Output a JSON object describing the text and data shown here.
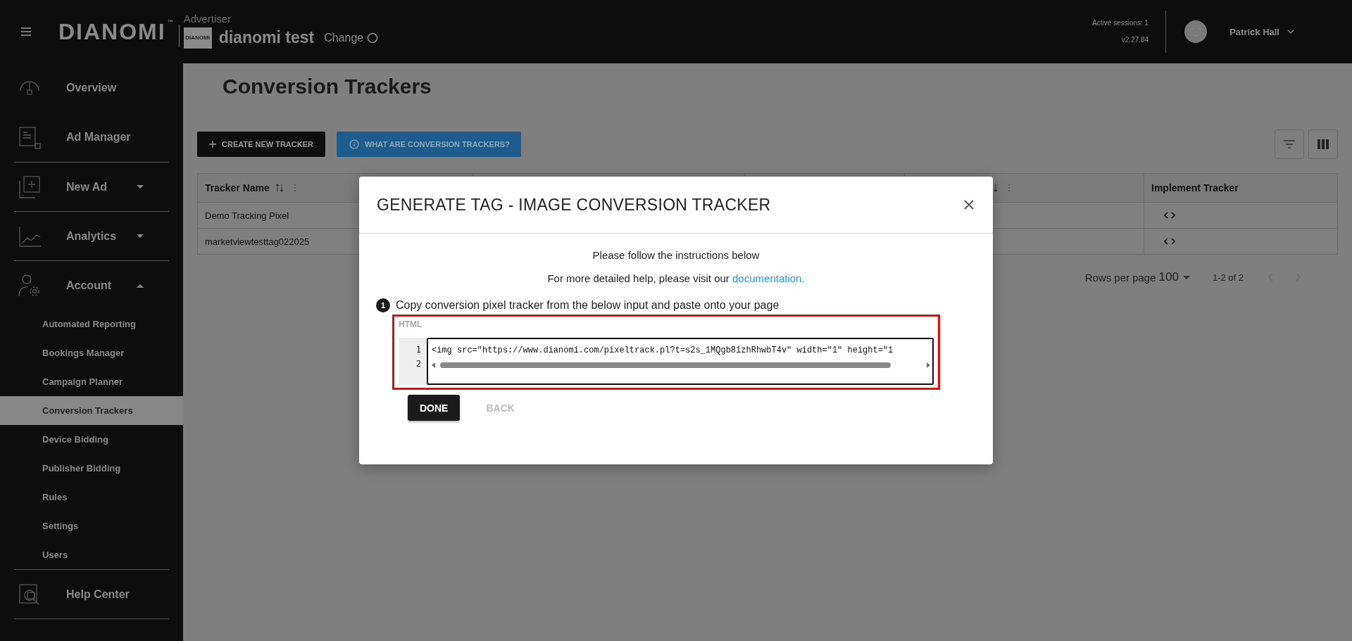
{
  "header": {
    "logo": "DIANOMI",
    "trademark": "™",
    "role_label": "Advertiser",
    "advertiser_logo_text": "DIANOMI",
    "advertiser_name": "dianomi test",
    "change_link": "Change",
    "sessions": "Active sessions: 1",
    "version": "v2.27.84",
    "user_name": "Patrick Hall"
  },
  "sidebar": {
    "items": [
      {
        "label": "Overview"
      },
      {
        "label": "Ad Manager"
      },
      {
        "label": "New Ad",
        "expanded": false
      },
      {
        "label": "Analytics",
        "expanded": false
      },
      {
        "label": "Account",
        "expanded": true,
        "children": [
          {
            "label": "Automated Reporting",
            "selected": false
          },
          {
            "label": "Bookings Manager",
            "selected": false
          },
          {
            "label": "Campaign Planner",
            "selected": false
          },
          {
            "label": "Conversion Trackers",
            "selected": true
          },
          {
            "label": "Device Bidding",
            "selected": false
          },
          {
            "label": "Publisher Bidding",
            "selected": false
          },
          {
            "label": "Rules",
            "selected": false
          },
          {
            "label": "Settings",
            "selected": false
          },
          {
            "label": "Users",
            "selected": false
          }
        ]
      },
      {
        "label": "Help Center"
      }
    ]
  },
  "page": {
    "title": "Conversion Trackers",
    "buttons": [
      {
        "label": "CREATE NEW TRACKER",
        "kind": "create"
      },
      {
        "label": "WHAT ARE CONVERSION TRACKERS?",
        "kind": "info"
      }
    ],
    "table": {
      "columns": [
        {
          "label": "Tracker Name",
          "sortable": true
        },
        {},
        {},
        {
          "sortable": true
        },
        {
          "label": "Implement Tracker",
          "sortable": false
        }
      ],
      "rows": [
        {
          "cells": [
            "Demo Tracking Pixel"
          ]
        },
        {
          "cells": [
            "marketviewtesttag022025"
          ]
        }
      ]
    },
    "pagination": {
      "rows_per_page_label": "Rows per page",
      "rows_per_page": "100",
      "range": "1-2 of 2"
    }
  },
  "modal": {
    "title": "GENERATE TAG - IMAGE CONVERSION TRACKER",
    "instructions": "Please follow the instructions below",
    "help_text": "For more detailed help, please visit our",
    "help_link": "documentation.",
    "step": {
      "number": "1",
      "text": "Copy conversion pixel tracker from the below input and paste onto your page"
    },
    "code": {
      "highlighted": true,
      "label": "HTML",
      "line_numbers": [
        "1",
        "2"
      ],
      "line": "<img src=\"https://www.dianomi.com/pixeltrack.pl?t=s2s_1MQgb81zhRhwbT4v\" width=\"1\" height=\"1"
    },
    "buttons": [
      {
        "label": "DONE",
        "disabled": false
      },
      {
        "label": "BACK",
        "disabled": true
      }
    ]
  }
}
